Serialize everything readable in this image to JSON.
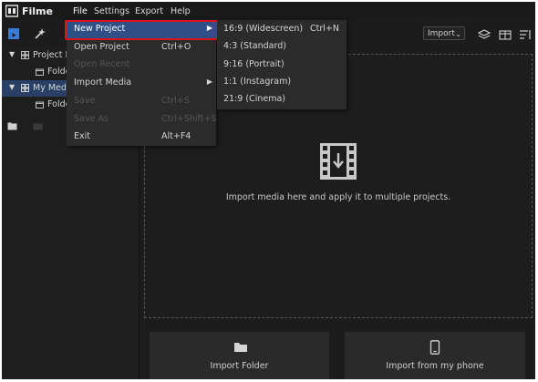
{
  "app": {
    "name": "Filme"
  },
  "menubar": [
    {
      "label": "File",
      "active": true
    },
    {
      "label": "Settings"
    },
    {
      "label": "Export"
    },
    {
      "label": "Help"
    }
  ],
  "toolbar": {
    "import_label": "Import"
  },
  "file_menu": {
    "items": [
      {
        "label": "New Project",
        "shortcut": "",
        "state": "hover",
        "submenu": true
      },
      {
        "label": "Open Project",
        "shortcut": "Ctrl+O",
        "state": "enabled"
      },
      {
        "label": "Open Recent",
        "shortcut": "",
        "state": "disabled"
      },
      {
        "label": "Import Media",
        "shortcut": "",
        "state": "enabled",
        "submenu": true
      },
      {
        "label": "Save",
        "shortcut": "Ctrl+S",
        "state": "disabled"
      },
      {
        "label": "Save As",
        "shortcut": "Ctrl+Shift+S",
        "state": "disabled"
      },
      {
        "label": "Exit",
        "shortcut": "Alt+F4",
        "state": "enabled"
      }
    ]
  },
  "new_project_submenu": {
    "items": [
      {
        "label": "16:9 (Widescreen)",
        "shortcut": "Ctrl+N"
      },
      {
        "label": "4:3 (Standard)",
        "shortcut": ""
      },
      {
        "label": "9:16 (Portrait)",
        "shortcut": ""
      },
      {
        "label": "1:1 (Instagram)",
        "shortcut": ""
      },
      {
        "label": "21:9 (Cinema)",
        "shortcut": ""
      }
    ]
  },
  "left_panel": {
    "tree": [
      {
        "label": "Project I",
        "level": 0,
        "expanded": true
      },
      {
        "label": "Folde",
        "level": 1
      },
      {
        "label": "My Med",
        "level": 0,
        "expanded": true,
        "selected": true
      },
      {
        "label": "Folde",
        "level": 1
      }
    ]
  },
  "main": {
    "drop_text": "Import media here and apply it to multiple projects.",
    "import_folder_label": "Import Folder",
    "import_phone_label": "Import from my phone"
  },
  "colors": {
    "highlight_border": "#d9151b",
    "hover_bg": "#2f4f86",
    "accent_blue": "#3a7bd5"
  }
}
